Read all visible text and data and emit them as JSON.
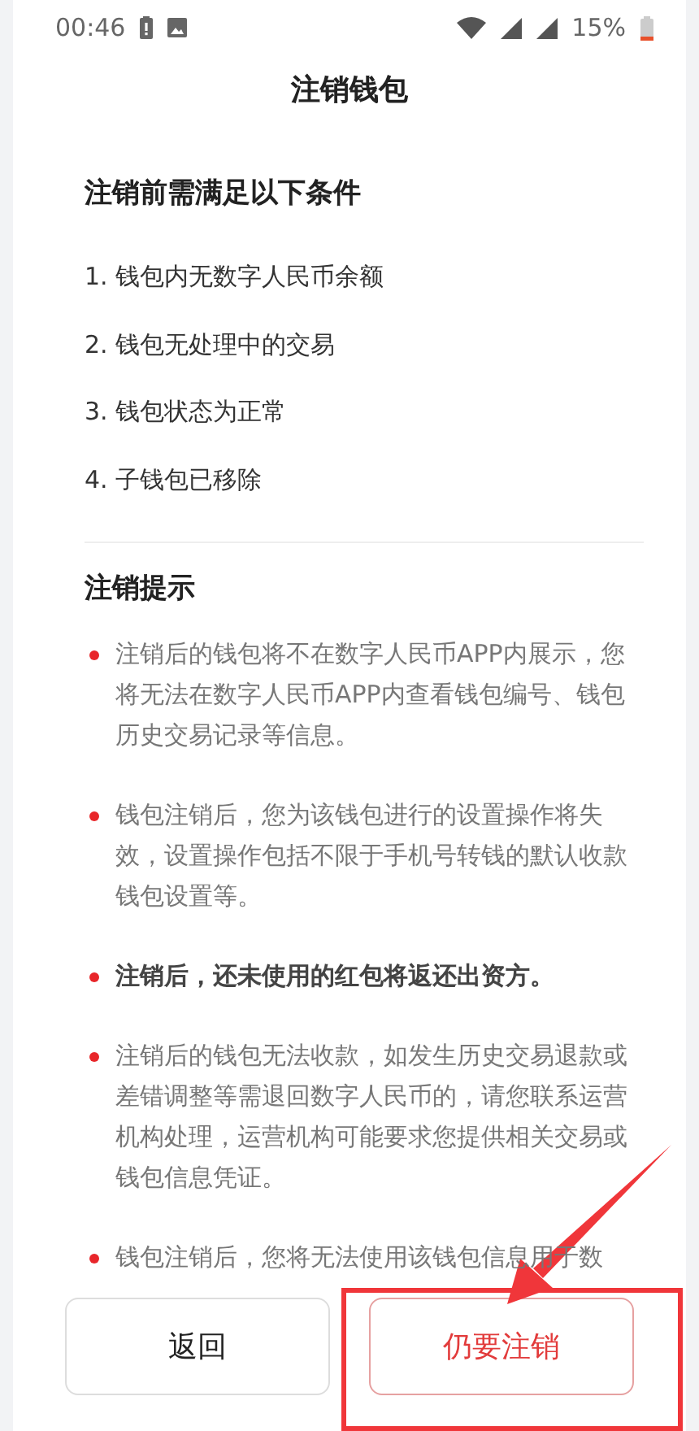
{
  "status_bar": {
    "time": "00:46",
    "battery": "15%"
  },
  "title": "注销钱包",
  "conditions": {
    "heading": "注销前需满足以下条件",
    "items": [
      "1. 钱包内无数字人民币余额",
      "2. 钱包无处理中的交易",
      "3. 钱包状态为正常",
      "4. 子钱包已移除"
    ]
  },
  "notices": {
    "heading": "注销提示",
    "items": [
      {
        "text": "注销后的钱包将不在数字人民币APP内展示，您将无法在数字人民币APP内查看钱包编号、钱包历史交易记录等信息。",
        "emphasis": false
      },
      {
        "text": "钱包注销后，您为该钱包进行的设置操作将失效，设置操作包括不限于手机号转钱的默认收款钱包设置等。",
        "emphasis": false
      },
      {
        "text": "注销后，还未使用的红包将返还出资方。",
        "emphasis": true
      },
      {
        "text": "注销后的钱包无法收款，如发生历史交易退款或差错调整等需退回数字人民币的，请您联系运营机构处理，运营机构可能要求您提供相关交易或钱包信息凭证。",
        "emphasis": false
      },
      {
        "text": "钱包注销后，您将无法使用该钱包信息用于数",
        "emphasis": false
      }
    ]
  },
  "buttons": [
    {
      "label": "返回",
      "kind": "secondary"
    },
    {
      "label": "仍要注销",
      "kind": "danger"
    }
  ]
}
